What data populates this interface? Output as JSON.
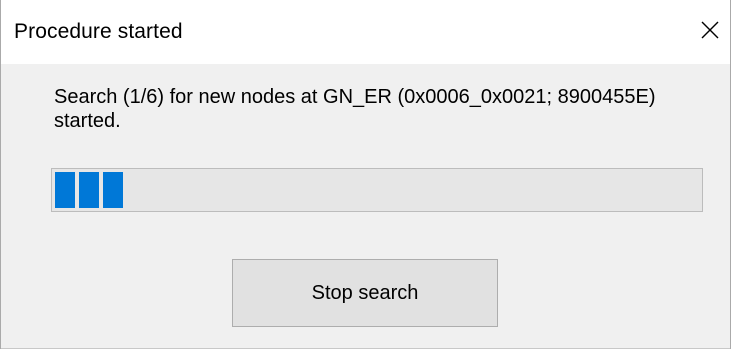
{
  "dialog": {
    "title": "Procedure started",
    "message": "Search (1/6) for new nodes at GN_ER (0x0006_0x0021; 8900455E) started.",
    "progress": {
      "blocks_filled": 3,
      "fill_color": "#0078d7"
    },
    "button_label": "Stop search",
    "close_icon": "close-icon"
  }
}
